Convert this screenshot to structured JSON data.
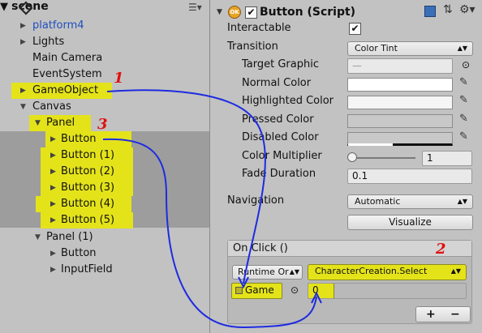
{
  "hierarchy": {
    "scene_title": "scene",
    "items": [
      {
        "label": "platform4",
        "blue": true
      },
      {
        "label": "Lights"
      },
      {
        "label": "Main Camera"
      },
      {
        "label": "EventSystem"
      },
      {
        "label": "GameObject"
      },
      {
        "label": "Canvas"
      },
      {
        "label": "Panel"
      },
      {
        "label": "Button"
      },
      {
        "label": "Button (1)"
      },
      {
        "label": "Button (2)"
      },
      {
        "label": "Button (3)"
      },
      {
        "label": "Button (4)"
      },
      {
        "label": "Button (5)"
      },
      {
        "label": "Panel (1)"
      },
      {
        "label": "Button"
      },
      {
        "label": "InputField"
      }
    ]
  },
  "inspector": {
    "component_title": "Button (Script)",
    "component_icon_text": "OK",
    "interactable_label": "Interactable",
    "interactable_checked": true,
    "transition_label": "Transition",
    "transition_value": "Color Tint",
    "target_graphic_label": "Target Graphic",
    "target_graphic_value": "—",
    "normal_color_label": "Normal Color",
    "highlighted_color_label": "Highlighted Color",
    "pressed_color_label": "Pressed Color",
    "disabled_color_label": "Disabled Color",
    "color_multiplier_label": "Color Multiplier",
    "color_multiplier_value": "1",
    "color_multiplier_fraction": 0,
    "fade_duration_label": "Fade Duration",
    "fade_duration_value": "0.1",
    "navigation_label": "Navigation",
    "navigation_value": "Automatic",
    "visualize_label": "Visualize",
    "onclick_title": "On Click ()",
    "runtime_value": "Runtime Or",
    "function_value": "CharacterCreation.Select",
    "object_value": "Game",
    "argument_value": "0",
    "add_label": "+",
    "remove_label": "−"
  },
  "annotations": {
    "one": "1",
    "two": "2",
    "three": "3"
  },
  "colors": {
    "highlight": "#e4e31a",
    "arrow": "#1e2be0",
    "annotation_red": "#e01010"
  }
}
